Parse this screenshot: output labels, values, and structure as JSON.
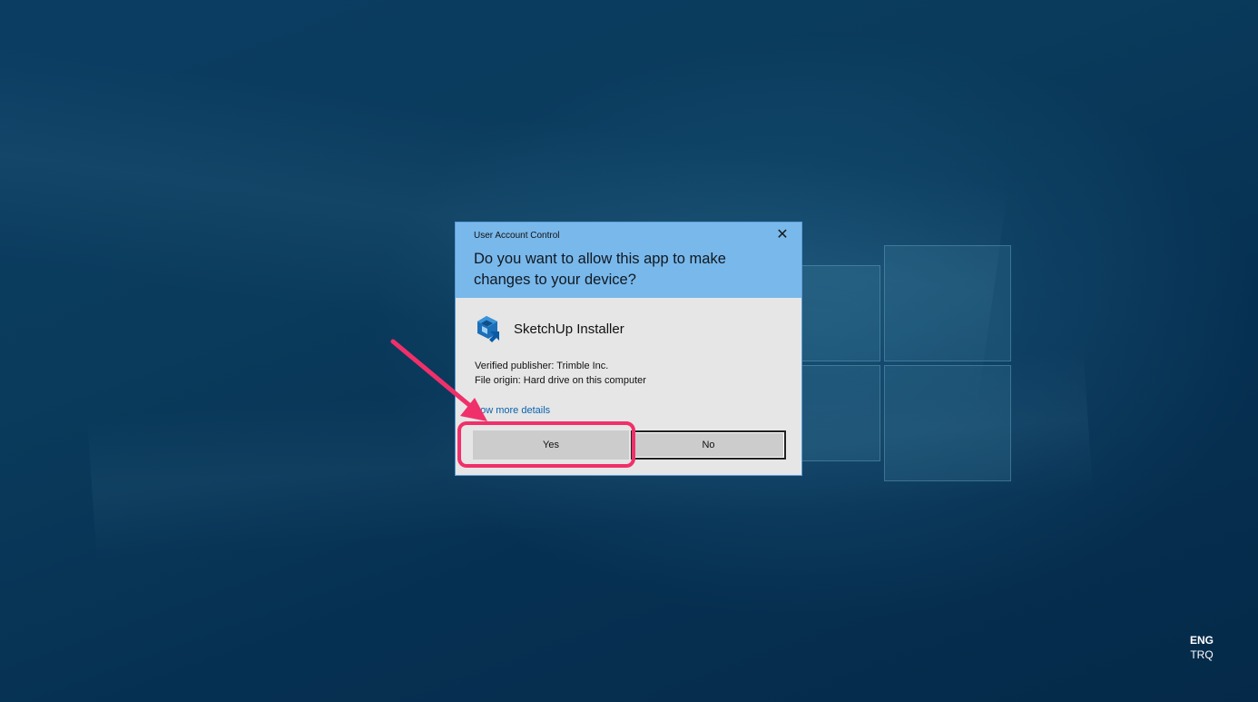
{
  "dialog": {
    "title": "User Account Control",
    "close_glyph": "✕",
    "question": "Do you want to allow this app to make changes to your device?",
    "app_name": "SketchUp Installer",
    "app_icon": "sketchup-icon",
    "publisher": "Verified publisher: Trimble Inc.",
    "origin": "File origin: Hard drive on this computer",
    "details_link": "how more details",
    "yes_label": "Yes",
    "no_label": "No",
    "header_color": "#79b8eb"
  },
  "annotation": {
    "color": "#f0306a"
  },
  "language": {
    "main": "ENG",
    "layout": "TRQ"
  }
}
